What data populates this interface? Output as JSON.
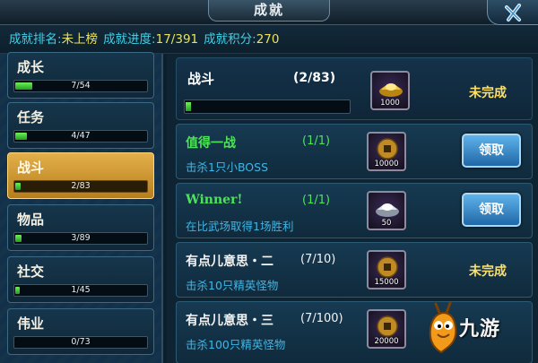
{
  "window": {
    "title": "成就"
  },
  "summary": {
    "rank_label": "成就排名:",
    "rank_value": "未上榜",
    "progress_label": "成就进度:",
    "progress_value": "17/391",
    "points_label": "成就积分:",
    "points_value": "270"
  },
  "categories": [
    {
      "name": "成长",
      "count": "7/54",
      "progress": 0.13,
      "active": false
    },
    {
      "name": "任务",
      "count": "4/47",
      "progress": 0.085,
      "active": false
    },
    {
      "name": "战斗",
      "count": "2/83",
      "progress": 0.024,
      "active": true
    },
    {
      "name": "物品",
      "count": "3/89",
      "progress": 0.034,
      "active": false
    },
    {
      "name": "社交",
      "count": "1/45",
      "progress": 0.022,
      "active": false
    },
    {
      "name": "伟业",
      "count": "0/73",
      "progress": 0.0,
      "active": false
    }
  ],
  "header": {
    "name": "战斗",
    "progress": "(2/83)",
    "progress_fraction": 0.024,
    "reward_amount": "1000",
    "reward_icon": "gold-ingot-icon",
    "status": "未完成"
  },
  "items": [
    {
      "name": "值得一战",
      "progress": "(1/1)",
      "desc": "击杀1只小BOSS",
      "reward_amount": "10000",
      "reward_icon": "copper-coin-icon",
      "action": "领取",
      "name_color": "green"
    },
    {
      "name": "Winner!",
      "progress": "(1/1)",
      "desc": "在比武场取得1场胜利",
      "reward_amount": "50",
      "reward_icon": "silver-ingot-icon",
      "action": "领取",
      "name_color": "green"
    },
    {
      "name": "有点儿意思・二",
      "progress": "(7/10)",
      "desc": "击杀10只精英怪物",
      "reward_amount": "15000",
      "reward_icon": "copper-coin-icon",
      "status": "未完成",
      "name_color": "white"
    },
    {
      "name": "有点儿意思・三",
      "progress": "(7/100)",
      "desc": "击杀100只精英怪物",
      "reward_amount": "20000",
      "reward_icon": "copper-coin-icon",
      "status": "",
      "name_color": "white"
    }
  ],
  "watermark": {
    "text": "九游"
  },
  "colors": {
    "label_cyan": "#3fd0e6",
    "value_yellow": "#e8e35a",
    "complete_green": "#4ee25a",
    "status_yellow": "#ffe066",
    "active_gold": "#e3b04b"
  }
}
